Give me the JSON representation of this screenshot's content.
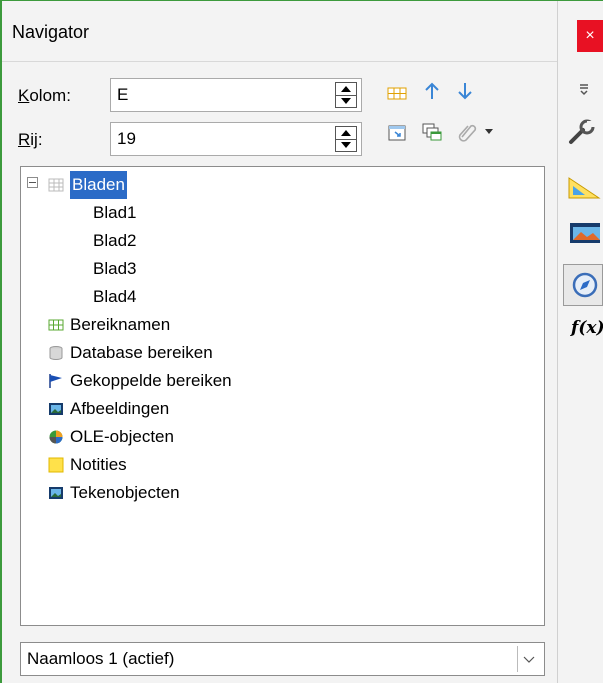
{
  "navigator": {
    "title": "Navigator",
    "column_label_prefix": "K",
    "column_label_rest": "olom:",
    "column_value": "E",
    "row_label_prefix": "R",
    "row_label_rest": "ij:",
    "row_value": "19",
    "tree": {
      "root": "Bladen",
      "sheets": [
        "Blad1",
        "Blad2",
        "Blad3",
        "Blad4"
      ],
      "categories": [
        "Bereiknamen",
        "Database bereiken",
        "Gekoppelde bereiken",
        "Afbeeldingen",
        "OLE-objecten",
        "Notities",
        "Tekenobjecten"
      ]
    },
    "document": "Naamloos 1 (actief)"
  },
  "sidebar": {
    "close_glyph": "×",
    "functions_label": "f(x)"
  }
}
